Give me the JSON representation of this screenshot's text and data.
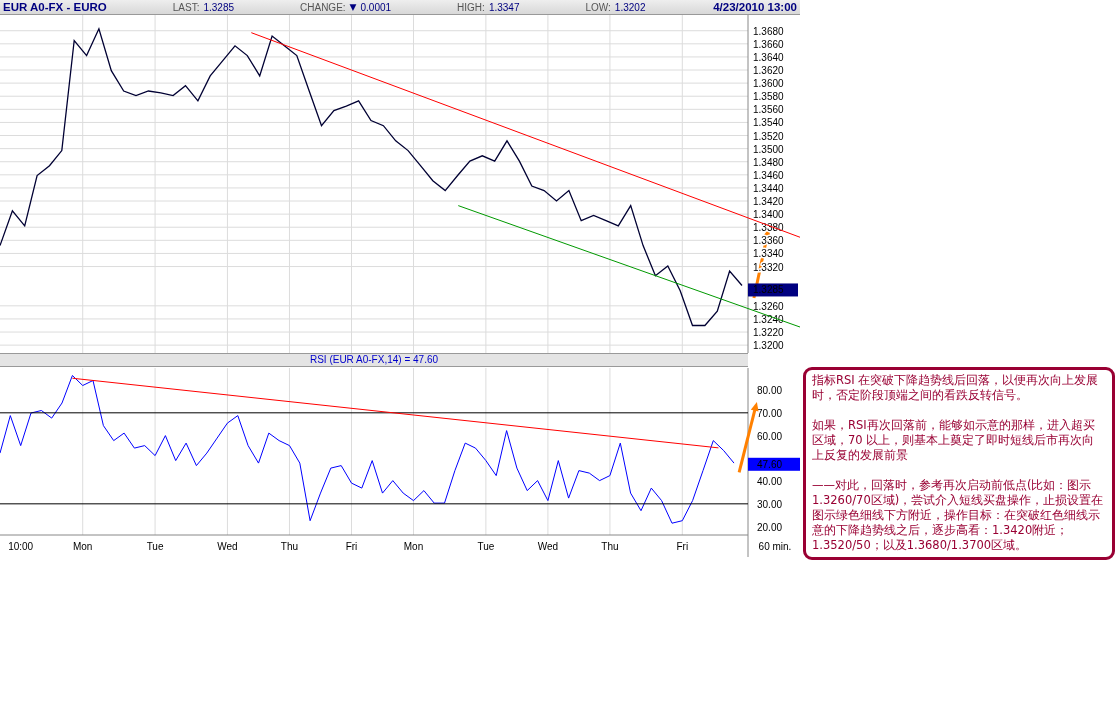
{
  "header": {
    "symbol": "EUR A0-FX - EURO",
    "last_label": "LAST:",
    "last": "1.3285",
    "change_label": "CHANGE:",
    "change_icon": "▼",
    "change": "0.0001",
    "high_label": "HIGH:",
    "high": "1.3347",
    "low_label": "LOW:",
    "low": "1.3202",
    "datetime": "4/23/2010 13:00"
  },
  "price_chart": {
    "current_price": "1.3285",
    "trend_lines": [
      {
        "color": "#ff0000"
      },
      {
        "color": "#009900"
      }
    ],
    "chart_data": {
      "type": "line",
      "series": [
        {
          "color": "#000033",
          "values": [
            1.3352,
            1.3405,
            1.3382,
            1.3459,
            1.3474,
            1.3497,
            1.3665,
            1.3642,
            1.3683,
            1.3619,
            1.3588,
            1.3581,
            1.3588,
            1.3585,
            1.3581,
            1.3596,
            1.3573,
            1.3611,
            1.3634,
            1.3657,
            1.3642,
            1.3611,
            1.3672,
            1.3657,
            1.3642,
            1.3588,
            1.3535,
            1.3558,
            1.3565,
            1.3573,
            1.3543,
            1.3535,
            1.3512,
            1.3497,
            1.3474,
            1.3451,
            1.3436,
            1.3459,
            1.3481,
            1.3489,
            1.3481,
            1.3512,
            1.3481,
            1.3443,
            1.3436,
            1.342,
            1.3436,
            1.339,
            1.3398,
            1.339,
            1.3382,
            1.3413,
            1.3352,
            1.3306,
            1.3321,
            1.3283,
            1.323,
            1.323,
            1.3252,
            1.3313,
            1.3291
          ]
        }
      ],
      "ylim": [
        1.3188,
        1.3704
      ],
      "grid": true,
      "yticks": [
        {
          "value": 1.32,
          "label": "1.3200"
        },
        {
          "value": 1.322,
          "label": "1.3220"
        },
        {
          "value": 1.324,
          "label": "1.3240"
        },
        {
          "value": 1.326,
          "label": "1.3260"
        },
        {
          "value": 1.332,
          "label": "1.3320"
        },
        {
          "value": 1.334,
          "label": "1.3340"
        },
        {
          "value": 1.336,
          "label": "1.3360"
        },
        {
          "value": 1.338,
          "label": "1.3380"
        },
        {
          "value": 1.34,
          "label": "1.3400"
        },
        {
          "value": 1.342,
          "label": "1.3420"
        },
        {
          "value": 1.344,
          "label": "1.3440"
        },
        {
          "value": 1.346,
          "label": "1.3460"
        },
        {
          "value": 1.348,
          "label": "1.3480"
        },
        {
          "value": 1.35,
          "label": "1.3500"
        },
        {
          "value": 1.352,
          "label": "1.3520"
        },
        {
          "value": 1.354,
          "label": "1.3540"
        },
        {
          "value": 1.356,
          "label": "1.3560"
        },
        {
          "value": 1.358,
          "label": "1.3580"
        },
        {
          "value": 1.36,
          "label": "1.3600"
        },
        {
          "value": 1.362,
          "label": "1.3620"
        },
        {
          "value": 1.364,
          "label": "1.3640"
        },
        {
          "value": 1.366,
          "label": "1.3660"
        },
        {
          "value": 1.368,
          "label": "1.3680"
        }
      ]
    }
  },
  "rsi_panel": {
    "title": "RSI (EUR A0-FX,14) = 47.60",
    "current_label": "47.60",
    "interval_label": "60 min.",
    "trend_lines": [
      {
        "color": "#ff0000"
      }
    ],
    "chart_data": {
      "type": "line",
      "categories": [
        null,
        null,
        "10:00",
        null,
        null,
        null,
        null,
        null,
        "Mon",
        null,
        null,
        null,
        null,
        null,
        null,
        "Tue",
        null,
        null,
        null,
        null,
        null,
        null,
        "Wed",
        null,
        null,
        null,
        null,
        null,
        "Thu",
        null,
        null,
        null,
        null,
        null,
        "Fri",
        null,
        null,
        null,
        null,
        null,
        "Mon",
        null,
        null,
        null,
        null,
        null,
        null,
        "Tue",
        null,
        null,
        null,
        null,
        null,
        "Wed",
        null,
        null,
        null,
        null,
        null,
        "Thu",
        null,
        null,
        null,
        null,
        null,
        null,
        "Fri",
        null,
        null,
        null,
        null,
        null
      ],
      "series": [
        {
          "color": "#0000ff",
          "values": [
            52.3,
            68.8,
            55.6,
            69.9,
            71,
            67.7,
            74.3,
            86.4,
            82,
            84.2,
            64.4,
            57.8,
            61.1,
            54.5,
            55.6,
            51.2,
            60,
            49,
            56.7,
            46.8,
            52.3,
            58.9,
            65.5,
            68.8,
            55.6,
            47.9,
            61.1,
            57.8,
            55.6,
            47.9,
            22.6,
            34.7,
            45.7,
            46.8,
            39.1,
            36.9,
            49,
            34.7,
            40.2,
            34.7,
            31.4,
            35.8,
            30.3,
            30.3,
            44.6,
            56.7,
            54.5,
            49,
            42.4,
            62.2,
            45.7,
            35.8,
            40.2,
            31.4,
            49,
            32.5,
            44.6,
            43.5,
            40.2,
            42.4,
            56.7,
            34.7,
            27,
            36.9,
            31.4,
            21.5,
            22.6,
            31.4,
            44.6,
            57.8,
            53.4,
            47.9
          ]
        }
      ],
      "ylim": [
        16.3,
        89.7
      ],
      "yticks": [
        {
          "value": 20,
          "label": "20.00"
        },
        {
          "value": 30,
          "label": "30.00"
        },
        {
          "value": 40,
          "label": "40.00"
        },
        {
          "value": 60,
          "label": "60.00"
        },
        {
          "value": 70,
          "label": "70.00"
        },
        {
          "value": 80,
          "label": "80.00"
        }
      ],
      "grid": true
    }
  },
  "note": {
    "paragraphs": [
      "指标RSI 在突破下降趋势线后回落，以便再次向上发展时，否定阶段顶端之间的看跌反转信号。",
      "如果，RSI再次回落前，能够如示意的那样，进入超买区域，70 以上，则基本上奠定了即时短线后市再次向上反复的发展前景",
      "——对此，回落时，参考再次启动前低点(比如：图示1.3260/70区域)，尝试介入短线买盘操作，止损设置在图示绿色细线下方附近，操作目标：在突破红色细线示意的下降趋势线之后，逐步高看：1.3420附近；1.3520/50；以及1.3680/1.3700区域。"
    ]
  }
}
